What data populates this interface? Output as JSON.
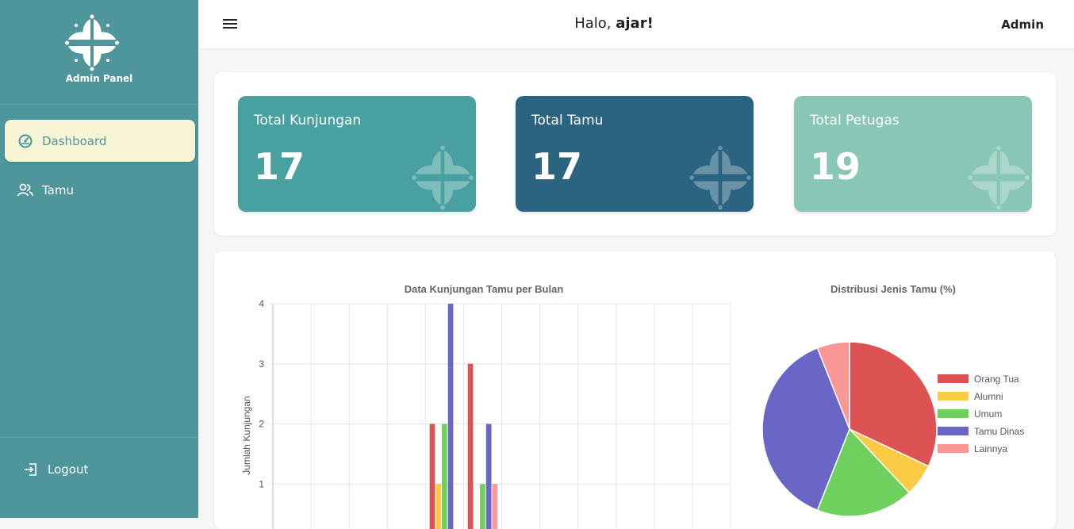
{
  "sidebar": {
    "brand_title": "Admin Panel",
    "items": [
      {
        "label": "Dashboard",
        "icon": "dashboard-icon",
        "active": true
      },
      {
        "label": "Tamu",
        "icon": "users-icon",
        "active": false
      }
    ],
    "logout_label": "Logout"
  },
  "header": {
    "greeting_prefix": "Halo, ",
    "user_first": "ajar!",
    "role": "Admin"
  },
  "stats": [
    {
      "label": "Total Kunjungan",
      "value": "17",
      "color": "#48a1a0"
    },
    {
      "label": "Total Tamu",
      "value": "17",
      "color": "#2a6481"
    },
    {
      "label": "Total Petugas",
      "value": "19",
      "color": "#89c6b5"
    }
  ],
  "chart_data": [
    {
      "type": "bar",
      "title": "Data Kunjungan Tamu per Bulan",
      "ylabel": "Jumlah Kunjungan",
      "ylim": [
        0,
        4
      ],
      "yticks": [
        "1",
        "2",
        "3",
        "4"
      ],
      "grid": true,
      "series": [
        {
          "color": "#dd5252",
          "values": [
            0,
            0,
            0,
            0,
            2,
            3,
            0,
            0,
            0,
            0,
            0,
            0
          ]
        },
        {
          "color": "#fccb46",
          "values": [
            0,
            0,
            0,
            0,
            1,
            0,
            0,
            0,
            0,
            0,
            0,
            0
          ]
        },
        {
          "color": "#6ed15e",
          "values": [
            0,
            0,
            0,
            0,
            2,
            1,
            0,
            0,
            0,
            0,
            0,
            0
          ]
        },
        {
          "color": "#6a66c6",
          "values": [
            0,
            0,
            0,
            0,
            4,
            2,
            0,
            0,
            0,
            0,
            0,
            0
          ]
        },
        {
          "color": "#fc9797",
          "values": [
            0,
            0,
            0,
            0,
            0,
            1,
            0,
            0,
            0,
            0,
            0,
            0
          ]
        }
      ]
    },
    {
      "type": "pie",
      "title": "Distribusi Jenis Tamu (%)",
      "legend_position": "right",
      "slices": [
        {
          "label": "Orang Tua",
          "value": 32,
          "color": "#dd5252"
        },
        {
          "label": "Alumni",
          "value": 6,
          "color": "#fccb46"
        },
        {
          "label": "Umum",
          "value": 18,
          "color": "#6ed15e"
        },
        {
          "label": "Tamu Dinas",
          "value": 38,
          "color": "#6a66c6"
        },
        {
          "label": "Lainnya",
          "value": 6,
          "color": "#fc9797"
        }
      ]
    }
  ]
}
